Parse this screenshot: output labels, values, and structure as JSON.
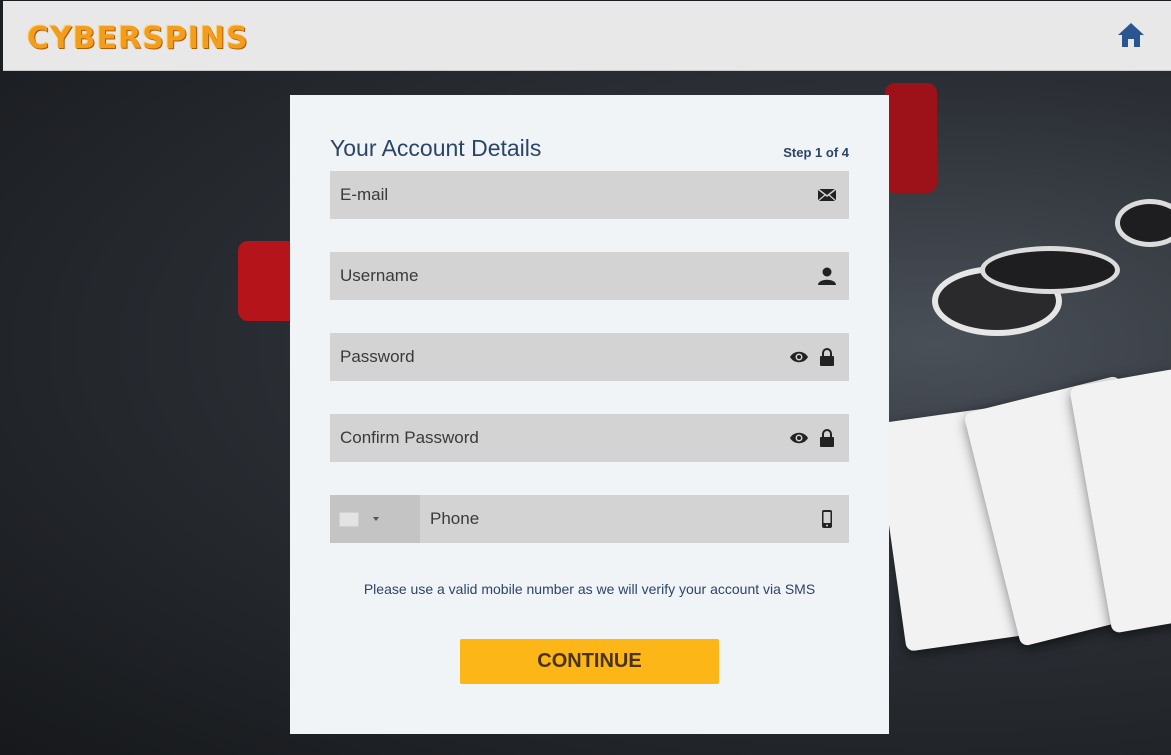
{
  "header": {
    "logo_text": "CYBERSPINS",
    "home_icon": "home-icon"
  },
  "form": {
    "title": "Your Account Details",
    "step": "Step 1 of 4",
    "email": {
      "placeholder": "E-mail",
      "icon": "envelope-icon"
    },
    "username": {
      "placeholder": "Username",
      "icon": "user-icon"
    },
    "password": {
      "placeholder": "Password",
      "icons": [
        "eye-icon",
        "lock-icon"
      ]
    },
    "confirm_password": {
      "placeholder": "Confirm Password",
      "icons": [
        "eye-icon",
        "lock-icon"
      ]
    },
    "phone": {
      "placeholder": "Phone",
      "icon": "mobile-phone-icon",
      "country_select": "flag-dropdown"
    },
    "hint": "Please use a valid mobile number as we will verify your account via SMS",
    "continue_label": "CONTINUE"
  },
  "colors": {
    "accent": "#fdb618",
    "title": "#2b4566",
    "field_bg": "#d3d3d3",
    "panel_bg": "#f1f4f7",
    "logo": "#f29d1e",
    "home_icon": "#2a5591"
  }
}
